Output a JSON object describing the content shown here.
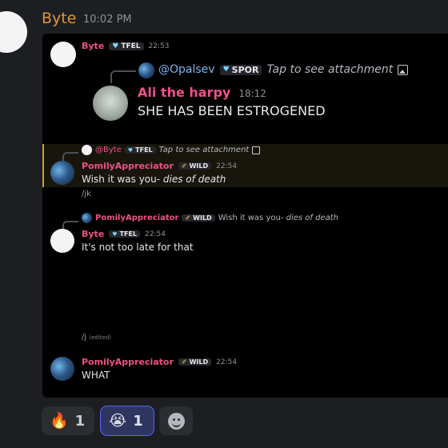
{
  "outer_message": {
    "author": "Byte",
    "time": "10:02 PM",
    "author_color": "#e2953c"
  },
  "embed": {
    "msg1": {
      "author": "Byte",
      "badge": "TFEL",
      "time": "22:53",
      "reply": {
        "mention": "@Opalsev",
        "badge": "SPOR",
        "text": "Tap to see attachment"
      },
      "inner": {
        "author": "Ali the harpy",
        "time": "18:12",
        "text": "SHE HAS BEEN ESTROGENED"
      }
    },
    "msg2": {
      "reply": {
        "mention": "@Byte",
        "badge": "TFEL",
        "text": "Tap to see attachment"
      },
      "author": "PomilyAppreciator",
      "badge": "WILD",
      "time": "22:54",
      "text_plain": "Wish it was you-",
      "text_italic": "dies of death",
      "followup": "/jk"
    },
    "msg3": {
      "reply": {
        "author": "PomilyAppreciator",
        "badge": "WILD",
        "text_plain": "Wish it was you-",
        "text_italic": "dies of death"
      },
      "author": "Byte",
      "badge": "TFEL",
      "time": "22:54",
      "text": "It's not too late for that",
      "followup": "/j",
      "edited": "(edited)"
    },
    "msg4": {
      "author": "PomilyAppreciator",
      "badge": "WILD",
      "time": "22:54",
      "text": "WHAT"
    }
  },
  "reactions": [
    {
      "emoji": "🔥",
      "count": "1",
      "icon": "fire-icon"
    },
    {
      "emoji": "😭",
      "count": "1",
      "icon": "crying-face-icon",
      "selected": true
    },
    {
      "icon": "add-reaction-icon"
    }
  ],
  "colors": {
    "pink": "#f04f8a",
    "embed_bg": "#000000",
    "highlight_border": "#c9a227"
  }
}
